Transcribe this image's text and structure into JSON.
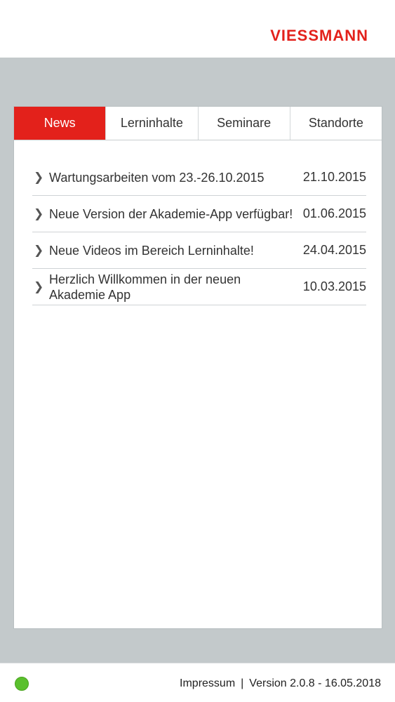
{
  "header": {
    "logo_text": "VIESSMANN"
  },
  "tabs": [
    {
      "label": "News",
      "active": true
    },
    {
      "label": "Lerninhalte",
      "active": false
    },
    {
      "label": "Seminare",
      "active": false
    },
    {
      "label": "Standorte",
      "active": false
    }
  ],
  "news": [
    {
      "title": "Wartungsarbeiten vom 23.-26.10.2015",
      "date": "21.10.2015"
    },
    {
      "title": "Neue Version der Akademie-App verfügbar!",
      "date": "01.06.2015"
    },
    {
      "title": "Neue Videos im Bereich Lerninhalte!",
      "date": "24.04.2015"
    },
    {
      "title": "Herzlich Willkommen in der neuen Akademie App",
      "date": "10.03.2015"
    }
  ],
  "footer": {
    "impressum": "Impressum",
    "separator": "|",
    "version": "Version 2.0.8 - 16.05.2018",
    "status_color": "#5ac02d"
  },
  "colors": {
    "accent": "#e3211b",
    "background_gray": "#c3c9cb"
  }
}
